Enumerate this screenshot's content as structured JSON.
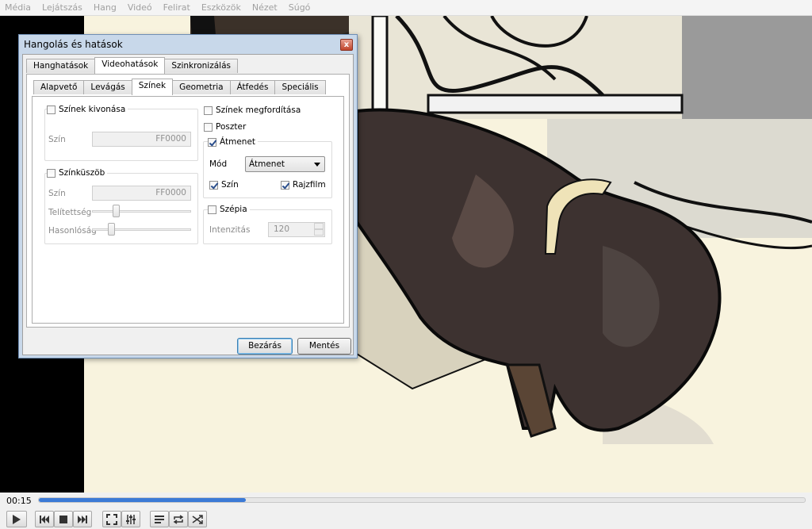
{
  "menu": [
    "Média",
    "Lejátszás",
    "Hang",
    "Videó",
    "Felirat",
    "Eszközök",
    "Nézet",
    "Súgó"
  ],
  "dialog": {
    "title": "Hangolás és hatások",
    "close_glyph": "x",
    "main_tabs": [
      "Hanghatások",
      "Videohatások",
      "Szinkronizálás"
    ],
    "main_active": "Videohatások",
    "sub_tabs": [
      "Alapvető",
      "Levágás",
      "Színek",
      "Geometria",
      "Átfedés",
      "Speciális"
    ],
    "sub_active": "Színek",
    "color_extraction": {
      "label": "Színek kivonása",
      "checked": false,
      "color_label": "Szín",
      "color_value": "FF0000"
    },
    "color_threshold": {
      "label": "Színküszöb",
      "checked": false,
      "color_label": "Szín",
      "color_value": "FF0000",
      "saturation_label": "Telítettség",
      "saturation_value": 0.22,
      "similarity_label": "Hasonlóság",
      "similarity_value": 0.17
    },
    "invert": {
      "label": "Színek megfordítása",
      "checked": false
    },
    "posterize": {
      "label": "Poszter",
      "checked": false
    },
    "gradient": {
      "label": "Átmenet",
      "checked": true,
      "mode_label": "Mód",
      "mode_value": "Átmenet",
      "color_label": "Szín",
      "color_checked": true,
      "cartoon_label": "Rajzfilm",
      "cartoon_checked": true
    },
    "sepia": {
      "label": "Szépia",
      "checked": false,
      "intensity_label": "Intenzitás",
      "intensity_value": "120"
    },
    "close_button": "Bezárás",
    "save_button": "Mentés"
  },
  "player": {
    "time": "00:15",
    "progress": 0.27
  },
  "colors": {
    "accent": "#3b7ad6",
    "video_bg": "#000000",
    "floor": "#f8f3de"
  }
}
